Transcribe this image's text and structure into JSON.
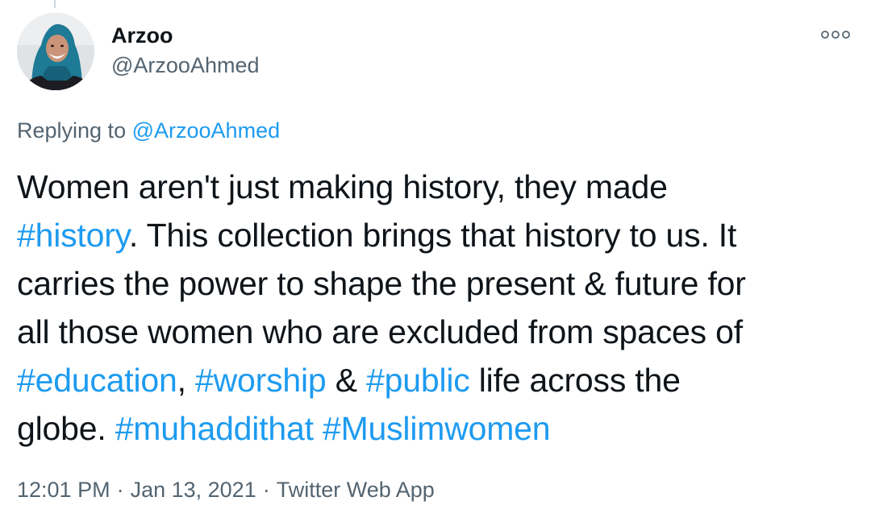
{
  "author": {
    "display_name": "Arzoo",
    "handle": "@ArzooAhmed",
    "avatar_icon": "profile-photo-icon"
  },
  "more_icon": "more-options-icon",
  "reply_context": {
    "prefix": "Replying to",
    "mention": "@ArzooAhmed"
  },
  "tweet": {
    "lines": [
      [
        {
          "text": "Women aren't just making history, they made",
          "type": "text"
        }
      ],
      [
        {
          "text": "#history",
          "type": "hashtag"
        },
        {
          "text": ". This collection brings that history to us. It",
          "type": "text"
        }
      ],
      [
        {
          "text": "carries the power to shape the present & future for",
          "type": "text"
        }
      ],
      [
        {
          "text": "all those women who are excluded from spaces of",
          "type": "text"
        }
      ],
      [
        {
          "text": "#education",
          "type": "hashtag"
        },
        {
          "text": ", ",
          "type": "text"
        },
        {
          "text": "#worship",
          "type": "hashtag"
        },
        {
          "text": " & ",
          "type": "text"
        },
        {
          "text": "#public",
          "type": "hashtag"
        },
        {
          "text": " life across the",
          "type": "text"
        }
      ],
      [
        {
          "text": "globe. ",
          "type": "text"
        },
        {
          "text": "#muhaddithat",
          "type": "hashtag"
        },
        {
          "text": " ",
          "type": "text"
        },
        {
          "text": "#Muslimwomen",
          "type": "hashtag"
        }
      ]
    ]
  },
  "meta": {
    "time": "12:01 PM",
    "date": "Jan 13, 2021",
    "source": "Twitter Web App",
    "separator": "·"
  },
  "colors": {
    "link": "#1d9bf0",
    "text": "#0f1419",
    "secondary": "#536471"
  }
}
